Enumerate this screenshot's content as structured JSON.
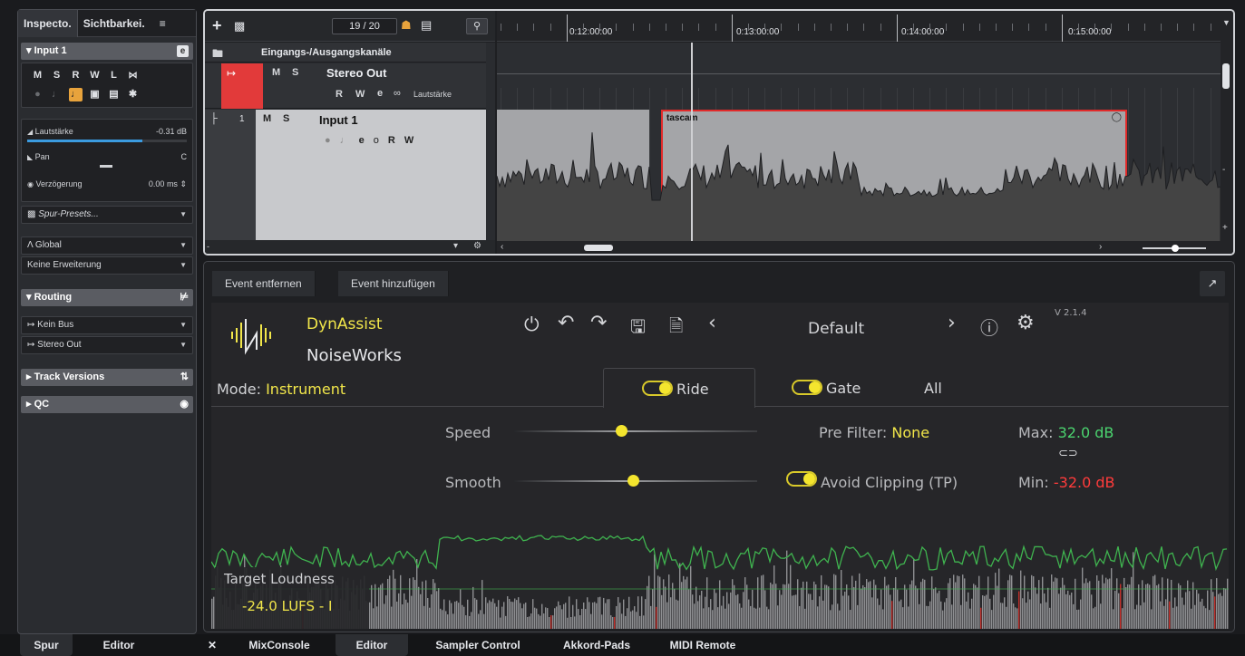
{
  "inspector": {
    "tabs": [
      "Inspecto.",
      "Sichtbarkei."
    ],
    "menu_icon": "menu-icon",
    "track_name": "Input 1",
    "buttons_row1": [
      "M",
      "S",
      "R",
      "W",
      "L"
    ],
    "volume_label": "Lautstärke",
    "volume_value": "-0.31 dB",
    "volume_level": 0.72,
    "pan_label": "Pan",
    "pan_value": "C",
    "delay_label": "Verzögerung",
    "delay_value": "0.00 ms",
    "presets_label": "Spur-Presets...",
    "global_label": "Global",
    "extension_label": "Keine Erweiterung",
    "routing_label": "Routing",
    "bus_in": "Kein Bus",
    "bus_out": "Stereo Out",
    "track_versions_label": "Track Versions",
    "qc_label": "QC"
  },
  "project": {
    "counter": "19 / 20",
    "folder_label": "Eingangs-/Ausgangskanäle",
    "stereo_out": {
      "name": "Stereo Out",
      "buttons": [
        "M",
        "S"
      ],
      "buttons2": [
        "R",
        "W"
      ],
      "param_label": "Lautstärke"
    },
    "input1": {
      "number": "1",
      "name": "Input 1",
      "buttons": [
        "M",
        "S"
      ],
      "buttons2": [
        "R",
        "W"
      ]
    },
    "ruler_labels": [
      "0:12:00:00",
      "0:13:00:00",
      "0:14:00:00",
      "0:15:00:00"
    ],
    "event_name": "tascam"
  },
  "lower": {
    "remove_event": "Event entfernen",
    "add_event": "Event hinzufügen",
    "plugin": {
      "brand1": "DynAssist",
      "brand2": "NoiseWorks",
      "preset": "Default",
      "version": "V 2.1.4",
      "mode_label": "Mode:",
      "mode_value": "Instrument",
      "tabs": [
        "Ride",
        "Gate",
        "All"
      ],
      "speed_label": "Speed",
      "speed_value": 0.44,
      "smooth_label": "Smooth",
      "smooth_value": 0.49,
      "prefilter_label": "Pre Filter:",
      "prefilter_value": "None",
      "avoid_clipping": "Avoid Clipping (TP)",
      "max_label": "Max:",
      "max_value": "32.0 dB",
      "min_label": "Min:",
      "min_value": "-32.0 dB",
      "target_label": "Target Loudness",
      "target_value": "-24.0 LUFS - I"
    }
  },
  "bottom_tabs": {
    "left": [
      "Spur",
      "Editor"
    ],
    "right": [
      "MixConsole",
      "Editor",
      "Sampler Control",
      "Akkord-Pads",
      "MIDI Remote"
    ]
  },
  "colors": {
    "accent_yellow": "#f1e64a",
    "event_red": "#e22a2a",
    "max_green": "#4bd46f",
    "min_red": "#ff3b3b",
    "stereo_out_red": "#e23a3a"
  }
}
